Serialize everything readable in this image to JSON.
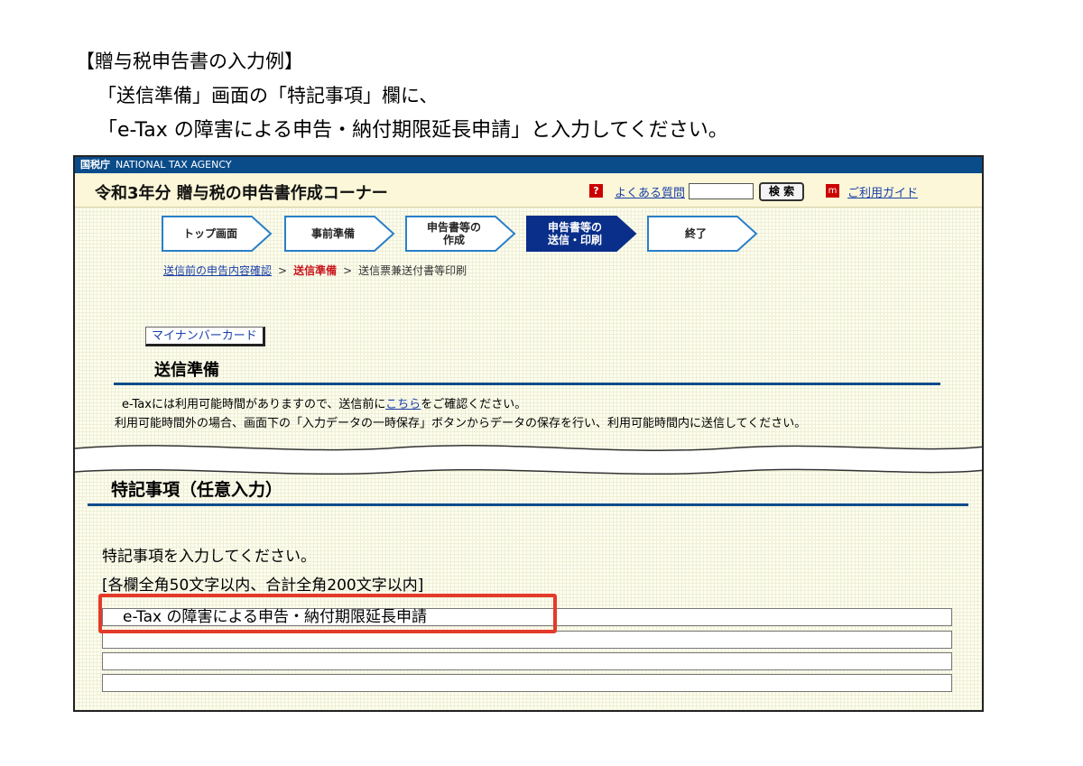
{
  "intro": {
    "heading": "【贈与税申告書の入力例】",
    "line1": "「送信準備」画面の「特記事項」欄に、",
    "line2": "「e-Tax の障害による申告・納付期限延長申請」と入力してください。"
  },
  "header": {
    "agency_emblem": "国税庁",
    "agency_name": "NATIONAL TAX AGENCY",
    "page_title": "令和3年分 贈与税の申告書作成コーナー",
    "help_icon_text": "?",
    "faq_label": "よくある質問",
    "search_button_label": "検 索",
    "guide_icon_text": "m",
    "guide_label": "ご利用ガイド"
  },
  "steps": [
    {
      "label": "トップ画面",
      "active": false
    },
    {
      "label": "事前準備",
      "active": false
    },
    {
      "label": "申告書等の作成",
      "line1": "申告書等の",
      "line2": "作成",
      "active": false
    },
    {
      "label": "申告書等の送信・印刷",
      "line1": "申告書等の",
      "line2": "送信・印刷",
      "active": true
    },
    {
      "label": "終了",
      "active": false
    }
  ],
  "breadcrumb": {
    "step1": "送信前の申告内容確認",
    "separator": ">",
    "step2": "送信準備",
    "step3": "送信票兼送付書等印刷"
  },
  "mynumber_button_label": "マイナンバーカード",
  "send_prep": {
    "heading": "送信準備",
    "notice1_prefix": "e-Taxには利用可能時間がありますので、送信前に",
    "notice1_link": "こちら",
    "notice1_suffix": "をご確認ください。",
    "notice2": "利用可能時間外の場合、画面下の「入力データの一時保存」ボタンからデータの保存を行い、利用可能時間内に送信してください。"
  },
  "special_notes": {
    "heading": "特記事項（任意入力）",
    "prompt": "特記事項を入力してください。",
    "limit": "[各欄全角50文字以内、合計全角200文字以内]",
    "fields": [
      "e-Tax の障害による申告・納付期限延長申請",
      "",
      "",
      ""
    ]
  },
  "colors": {
    "brand_blue": "#0a4c8a",
    "highlight_red": "#e43a2a",
    "active_step_fill": "#0a2f8a",
    "current_crumb_red": "#c8161d"
  }
}
